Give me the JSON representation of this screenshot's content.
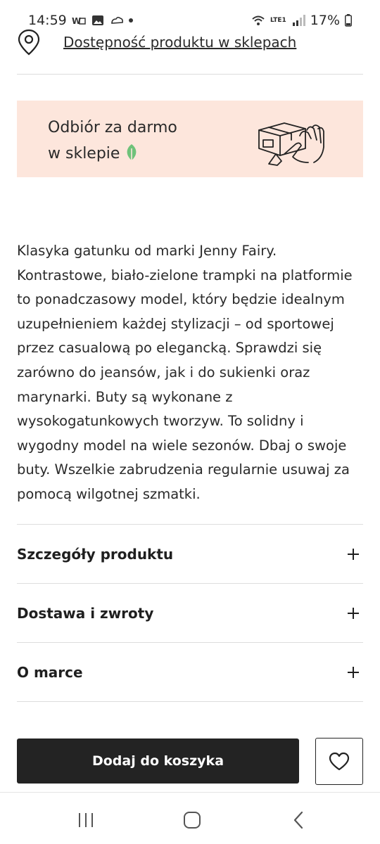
{
  "status_bar": {
    "time": "14:59",
    "battery": "17%",
    "network": "LTE1"
  },
  "availability": {
    "link_text": "Dostępność produktu w sklepach"
  },
  "promo": {
    "line1": "Odbiór za darmo",
    "line2": "w sklepie",
    "background": "#fde6dc",
    "leaf_color": "#6fc27a"
  },
  "description": {
    "text": "Klasyka gatunku od marki Jenny Fairy. Kontrastowe, biało-zielone trampki na platformie to ponadczasowy model, który będzie idealnym uzupełnieniem każdej stylizacji – od sportowej przez casualową po elegancką. Sprawdzi się zarówno do jeansów, jak i do sukienki oraz marynarki. Buty są wykonane z wysokogatunkowych tworzyw. To solidny i wygodny model na wiele sezonów. Dbaj o swoje buty. Wszelkie zabrudzenia regularnie usuwaj za pomocą wilgotnej szmatki."
  },
  "accordion": [
    {
      "title": "Szczegóły produktu"
    },
    {
      "title": "Dostawa i zwroty"
    },
    {
      "title": "O marce"
    }
  ],
  "actions": {
    "add_to_cart": "Dodaj do koszyka",
    "button_color": "#232323"
  }
}
